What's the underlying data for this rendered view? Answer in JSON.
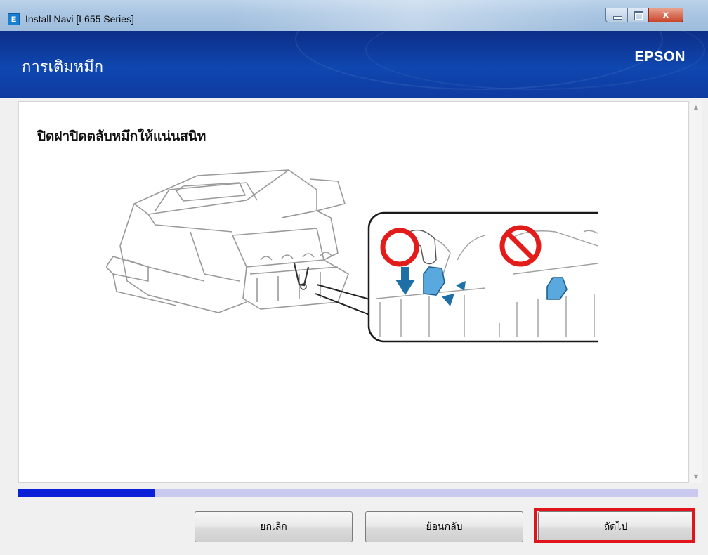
{
  "window": {
    "title": "Install Navi [L655 Series]",
    "app_icon_glyph": "E",
    "close_glyph": "x"
  },
  "header": {
    "title": "การเติมหมึก",
    "brand": "EPSON"
  },
  "content": {
    "instruction": "ปิดฝาปิดตลับหมึกให้แน่นสนิท",
    "illustration": {
      "correct_icon": "circle-ok-icon",
      "wrong_icon": "prohibited-icon",
      "accent_color": "#5aa9de",
      "mark_color": "#e21b1b"
    }
  },
  "progress": {
    "value": 0.2
  },
  "buttons": {
    "cancel": "ยกเลิก",
    "back": "ย้อนกลับ",
    "next": "ถัดไป"
  },
  "colors": {
    "header_blue": "#0f47b0",
    "progress_fill": "#0a1fd8",
    "highlight": "#e0151b"
  }
}
